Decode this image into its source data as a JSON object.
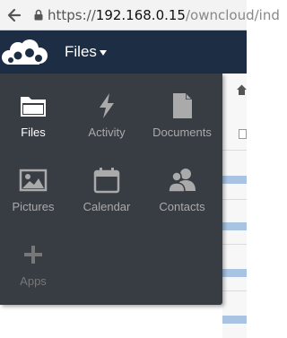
{
  "browser": {
    "url_scheme": "https://",
    "url_host": "192.168.0.15",
    "url_path": "/owncloud/ind"
  },
  "header": {
    "app_title": "Files"
  },
  "app_menu": {
    "items": [
      {
        "label": "Files",
        "icon": "folder-icon",
        "active": true
      },
      {
        "label": "Activity",
        "icon": "lightning-icon",
        "active": false
      },
      {
        "label": "Documents",
        "icon": "document-icon",
        "active": false
      },
      {
        "label": "Pictures",
        "icon": "picture-icon",
        "active": false
      },
      {
        "label": "Calendar",
        "icon": "calendar-icon",
        "active": false
      },
      {
        "label": "Contacts",
        "icon": "contacts-icon",
        "active": false
      },
      {
        "label": "Apps",
        "icon": "plus-icon",
        "active": false
      }
    ]
  },
  "colors": {
    "header_bg": "#1d2d44",
    "menu_bg": "#383c43",
    "active_label": "#ffffff",
    "inactive_label": "#aaaaaa"
  }
}
